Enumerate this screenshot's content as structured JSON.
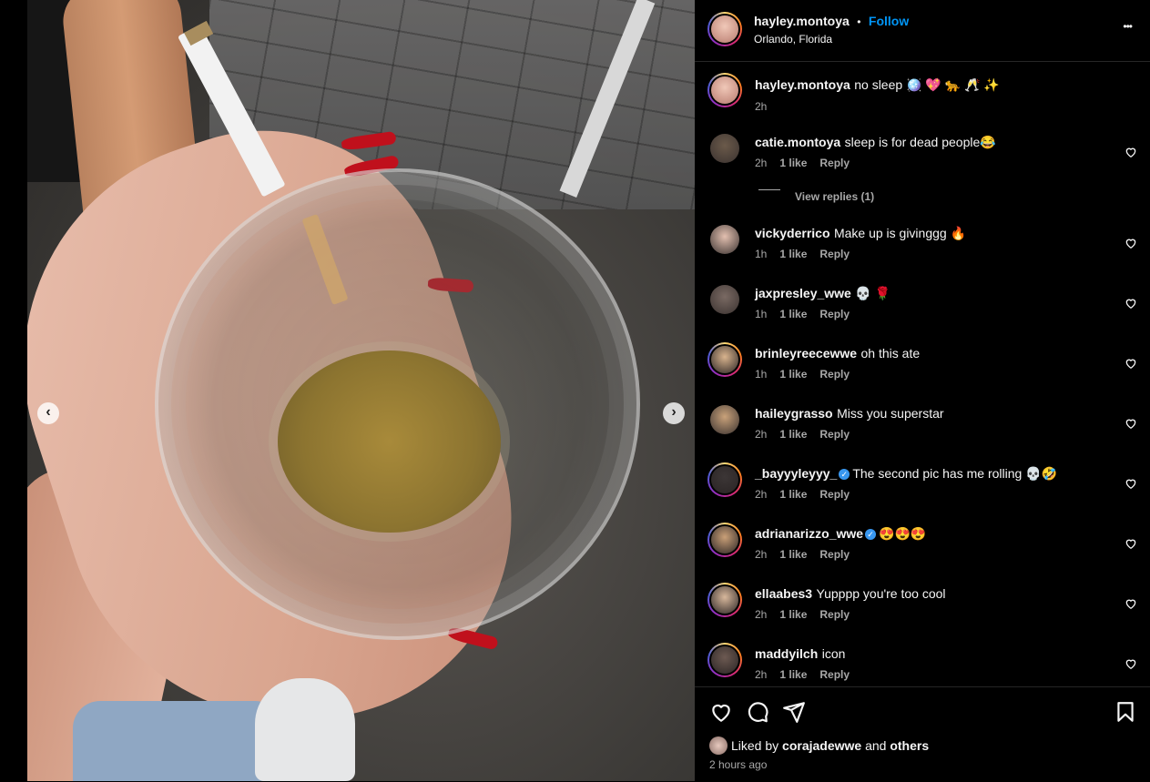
{
  "post": {
    "username": "hayley.montoya",
    "separator": "•",
    "follow_label": "Follow",
    "location": "Orlando, Florida",
    "more_label": "•••",
    "caption": "no sleep 🪩 💖 🐆 🥂 ✨",
    "caption_time": "2h"
  },
  "nav": {
    "prev": "‹",
    "next": "›"
  },
  "comments": [
    {
      "username": "catie.montoya",
      "verified": false,
      "text": "sleep is for dead people😂",
      "time": "2h",
      "likes": "1 like",
      "reply": "Reply",
      "ring": false,
      "avatar_color": "#6b5a4a"
    },
    {
      "username": "vickyderrico",
      "verified": false,
      "text": "Make up is givinggg 🔥",
      "time": "1h",
      "likes": "1 like",
      "reply": "Reply",
      "ring": false,
      "avatar_color": "#e3c0b0"
    },
    {
      "username": "jaxpresley_wwe",
      "verified": false,
      "text": "💀 🌹",
      "time": "1h",
      "likes": "1 like",
      "reply": "Reply",
      "ring": false,
      "avatar_color": "#7a6a63"
    },
    {
      "username": "brinleyreecewwe",
      "verified": false,
      "text": "oh this ate",
      "time": "1h",
      "likes": "1 like",
      "reply": "Reply",
      "ring": true,
      "avatar_color": "#d9b48e"
    },
    {
      "username": "haileygrasso",
      "verified": false,
      "text": "Miss you superstar",
      "time": "2h",
      "likes": "1 like",
      "reply": "Reply",
      "ring": false,
      "avatar_color": "#c9a27a"
    },
    {
      "username": "_bayyyleyyy_",
      "verified": true,
      "text": "The second pic has me rolling 💀🤣",
      "time": "2h",
      "likes": "1 like",
      "reply": "Reply",
      "ring": true,
      "avatar_color": "#3c3636"
    },
    {
      "username": "adrianarizzo_wwe",
      "verified": true,
      "text": "😍😍😍",
      "time": "2h",
      "likes": "1 like",
      "reply": "Reply",
      "ring": true,
      "avatar_color": "#caa078"
    },
    {
      "username": "ellaabes3",
      "verified": false,
      "text": "Yupppp you're too cool",
      "time": "2h",
      "likes": "1 like",
      "reply": "Reply",
      "ring": true,
      "avatar_color": "#d8b89c"
    },
    {
      "username": "maddyilch",
      "verified": false,
      "text": "icon",
      "time": "2h",
      "likes": "1 like",
      "reply": "Reply",
      "ring": true,
      "avatar_color": "#6d5a52"
    }
  ],
  "view_replies": "View replies (1)",
  "footer": {
    "liked_by_prefix": "Liked by",
    "liked_by_user": "corajadewwe",
    "liked_by_and": "and",
    "liked_by_others": "others",
    "timestamp": "2 hours ago"
  },
  "colors": {
    "accent": "#0095f6",
    "muted": "#a8a8a8",
    "divider": "#262626"
  }
}
